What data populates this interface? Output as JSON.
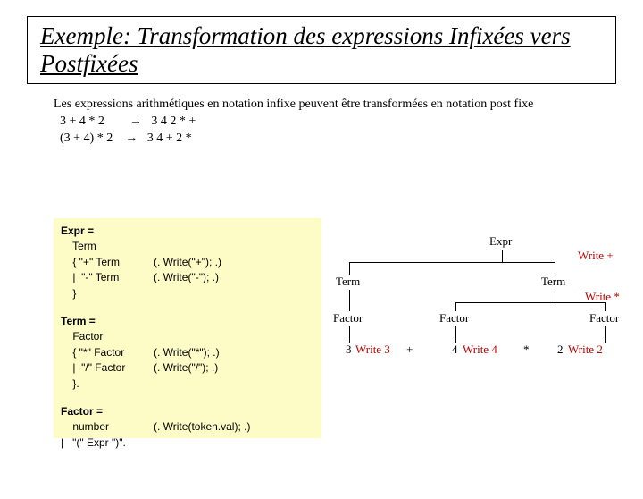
{
  "title": "Exemple: Transformation des expressions Infixées vers Postfixées",
  "intro": {
    "lead": "Les expressions arithmétiques en notation infixe peuvent être transformées en notation post fixe",
    "ex1_l": "  3 + 4 * 2",
    "ex1_a": "→",
    "ex1_r": "   3 4 2 * +",
    "ex2_l": "  (3 + 4) * 2",
    "ex2_a": "→",
    "ex2_r": "   3 4 + 2 *"
  },
  "grammar": {
    "expr_head": "Expr =",
    "expr_l1_l": "    Term",
    "expr_l2_l": "    { \"+\" Term",
    "expr_l2_r": "(. Write(\"+\"); .)",
    "expr_l3_l": "    |  \"-\" Term",
    "expr_l3_r": "(. Write(\"-\"); .)",
    "expr_l4_l": "    }",
    "term_head": "Term =",
    "term_l1_l": "    Factor",
    "term_l2_l": "    { \"*\" Factor",
    "term_l2_r": "(. Write(\"*\"); .)",
    "term_l3_l": "    |  \"/\" Factor",
    "term_l3_r": "(. Write(\"/\"); .)",
    "term_l4_l": "    }.",
    "fact_head": "Factor =",
    "fact_l1_l": "    number",
    "fact_l1_r": "(. Write(token.val); .)",
    "fact_l2_l": "|   \"(\" Expr \")\"."
  },
  "tree": {
    "expr": "Expr",
    "write_plus": "Write +",
    "term": "Term",
    "write_star": "Write *",
    "factor": "Factor",
    "n3": "3",
    "w3": "Write 3",
    "plus": "+",
    "n4": "4",
    "w4": "Write 4",
    "star": "*",
    "n2": "2",
    "w2": "Write 2"
  }
}
